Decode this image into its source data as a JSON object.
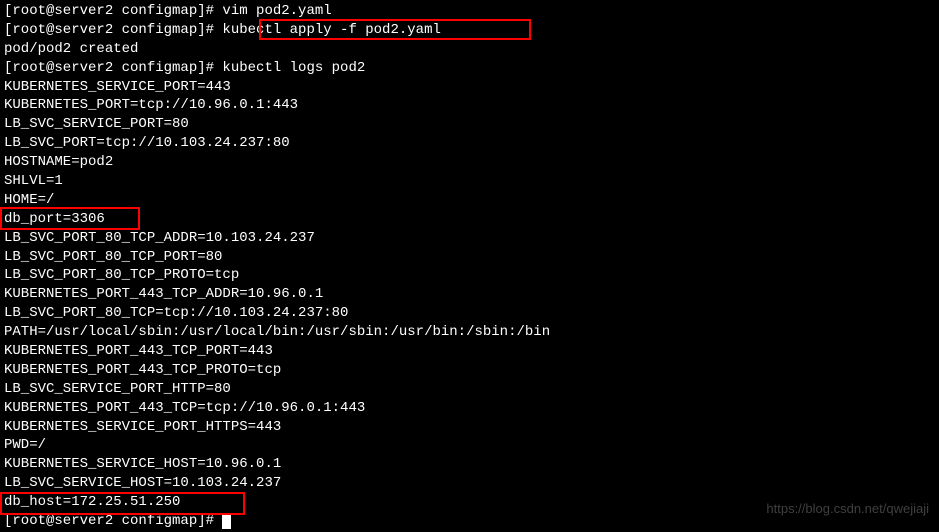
{
  "lines": {
    "l00": "[root@server2 configmap]# vim pod2.yaml",
    "l01": "[root@server2 configmap]# kubectl apply -f pod2.yaml",
    "l02": "pod/pod2 created",
    "l03": "[root@server2 configmap]# kubectl logs pod2",
    "l04": "KUBERNETES_SERVICE_PORT=443",
    "l05": "KUBERNETES_PORT=tcp://10.96.0.1:443",
    "l06": "LB_SVC_SERVICE_PORT=80",
    "l07": "LB_SVC_PORT=tcp://10.103.24.237:80",
    "l08": "HOSTNAME=pod2",
    "l09": "SHLVL=1",
    "l10": "HOME=/",
    "l11": "db_port=3306",
    "l12": "LB_SVC_PORT_80_TCP_ADDR=10.103.24.237",
    "l13": "LB_SVC_PORT_80_TCP_PORT=80",
    "l14": "LB_SVC_PORT_80_TCP_PROTO=tcp",
    "l15": "KUBERNETES_PORT_443_TCP_ADDR=10.96.0.1",
    "l16": "LB_SVC_PORT_80_TCP=tcp://10.103.24.237:80",
    "l17": "PATH=/usr/local/sbin:/usr/local/bin:/usr/sbin:/usr/bin:/sbin:/bin",
    "l18": "KUBERNETES_PORT_443_TCP_PORT=443",
    "l19": "KUBERNETES_PORT_443_TCP_PROTO=tcp",
    "l20": "LB_SVC_SERVICE_PORT_HTTP=80",
    "l21": "KUBERNETES_PORT_443_TCP=tcp://10.96.0.1:443",
    "l22": "KUBERNETES_SERVICE_PORT_HTTPS=443",
    "l23": "PWD=/",
    "l24": "KUBERNETES_SERVICE_HOST=10.96.0.1",
    "l25": "LB_SVC_SERVICE_HOST=10.103.24.237",
    "l26": "db_host=172.25.51.250",
    "l27": "[root@server2 configmap]# "
  },
  "watermark": "https://blog.csdn.net/qwejiaji"
}
